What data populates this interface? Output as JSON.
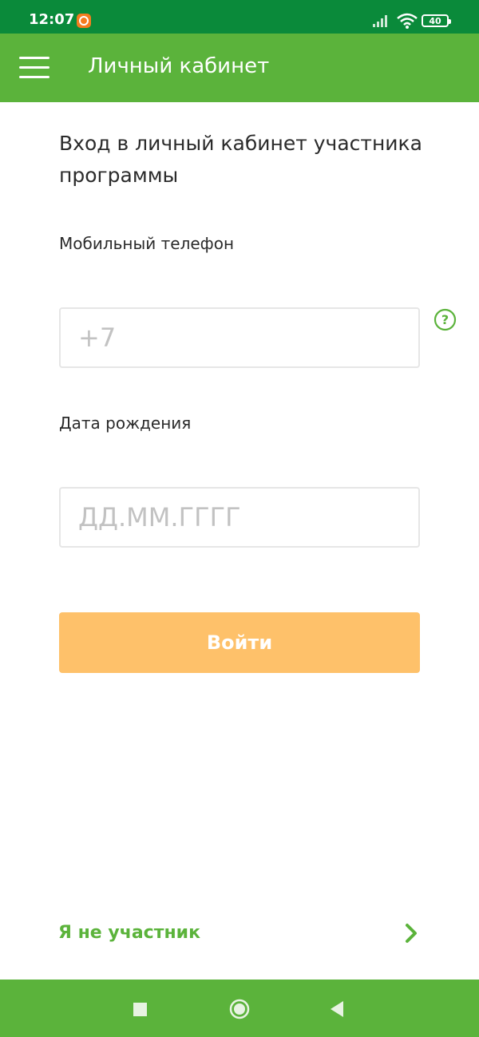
{
  "status_bar": {
    "time": "12:07",
    "battery": "40",
    "icons": [
      "app-notification-icon",
      "signal-icon",
      "wifi-icon",
      "battery-icon"
    ]
  },
  "app_bar": {
    "title": "Личный кабинет",
    "menu_icon": "hamburger-menu-icon"
  },
  "form": {
    "heading": "Вход в личный кабинет участника программы",
    "phone": {
      "label": "Мобильный телефон",
      "placeholder": "+7",
      "value": ""
    },
    "birthdate": {
      "label": "Дата рождения",
      "placeholder": "ДД.ММ.ГГГГ",
      "value": ""
    },
    "help_icon": "question-circle-icon",
    "submit_label": "Войти"
  },
  "footer": {
    "not_member_label": "Я не участник",
    "arrow_icon": "chevron-right-icon"
  },
  "navigation": {
    "icons": [
      "square-recents-icon",
      "circle-home-icon",
      "triangle-back-icon"
    ]
  },
  "colors": {
    "status_bar": "#0a8a3a",
    "primary_green": "#5bb33b",
    "button_orange": "#fec16a",
    "text_dark": "#2b2b2b",
    "placeholder": "#c2c2c2",
    "input_border": "#e6e6e6"
  }
}
